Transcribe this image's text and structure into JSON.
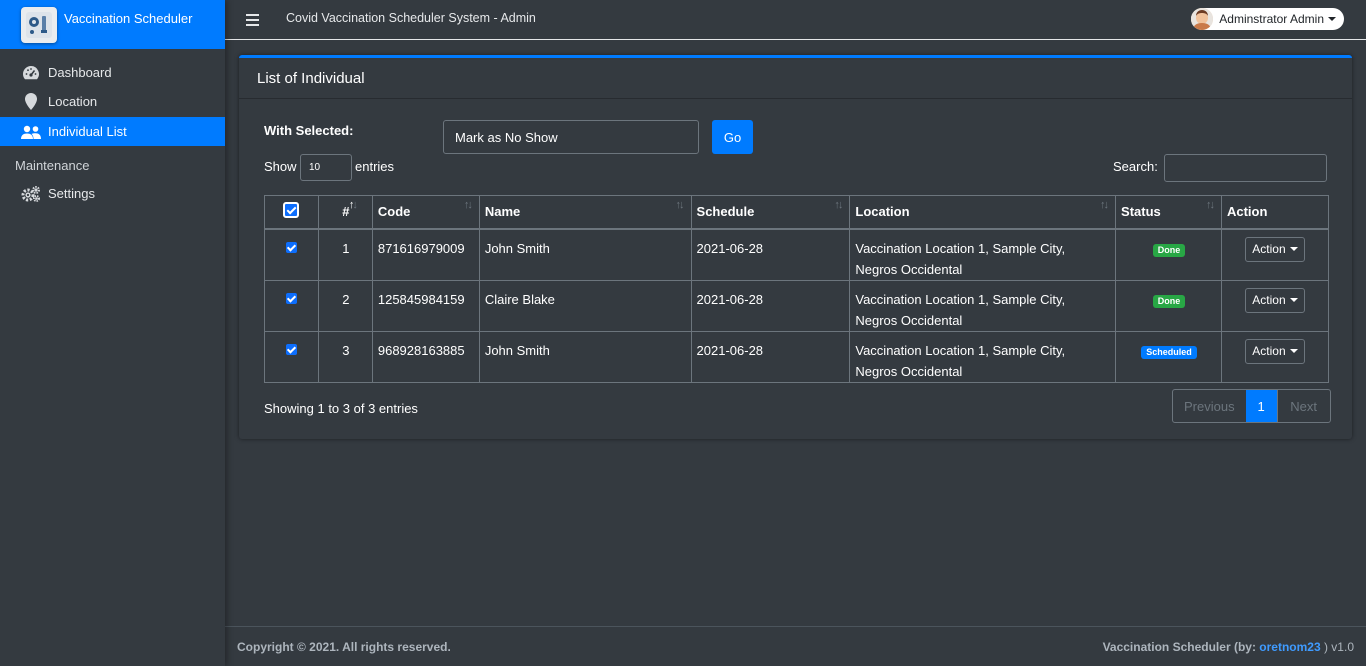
{
  "brand": {
    "title": "Vaccination Scheduler"
  },
  "sidebar": {
    "items": [
      {
        "label": "Dashboard",
        "icon": "dashboard-icon"
      },
      {
        "label": "Location",
        "icon": "map-marker-icon"
      },
      {
        "label": "Individual List",
        "icon": "users-icon",
        "active": true
      }
    ],
    "maintenance_header": "Maintenance",
    "maintenance_items": [
      {
        "label": "Settings",
        "icon": "gears-icon"
      }
    ]
  },
  "topbar": {
    "title": "Covid Vaccination Scheduler System - Admin",
    "user_name": "Adminstrator Admin"
  },
  "card": {
    "title": "List of Individual",
    "with_selected_label": "With Selected:",
    "bulk_action_value": "Mark as No Show",
    "go_label": "Go",
    "show_label": "Show",
    "entries_value": "10",
    "entries_label": "entries",
    "search_label": "Search:"
  },
  "table": {
    "headers": [
      "#",
      "Code",
      "Name",
      "Schedule",
      "Location",
      "Status",
      "Action"
    ],
    "rows": [
      {
        "num": "1",
        "code": "871616979009",
        "name": "John Smith",
        "schedule": "2021-06-28",
        "location_1": "Vaccination Location 1, Sample City,",
        "location_2": "Negros Occidental",
        "status": "Done",
        "action": "Action"
      },
      {
        "num": "2",
        "code": "125845984159",
        "name": "Claire Blake",
        "schedule": "2021-06-28",
        "location_1": "Vaccination Location 1, Sample City,",
        "location_2": "Negros Occidental",
        "status": "Done",
        "action": "Action"
      },
      {
        "num": "3",
        "code": "968928163885",
        "name": "John Smith",
        "schedule": "2021-06-28",
        "location_1": "Vaccination Location 1, Sample City,",
        "location_2": "Negros Occidental",
        "status": "Scheduled",
        "action": "Action"
      }
    ]
  },
  "pagination": {
    "info": "Showing 1 to 3 of 3 entries",
    "previous": "Previous",
    "current": "1",
    "next": "Next"
  },
  "footer": {
    "copyright": "Copyright © 2021. All rights reserved.",
    "credit_prefix": "Vaccination Scheduler (by: ",
    "credit_author": "oretnom23",
    "credit_suffix": " ) v1.0"
  },
  "colors": {
    "primary": "#007bff",
    "background": "#343a40",
    "success": "#28a745",
    "scheduled": "#007bff"
  }
}
